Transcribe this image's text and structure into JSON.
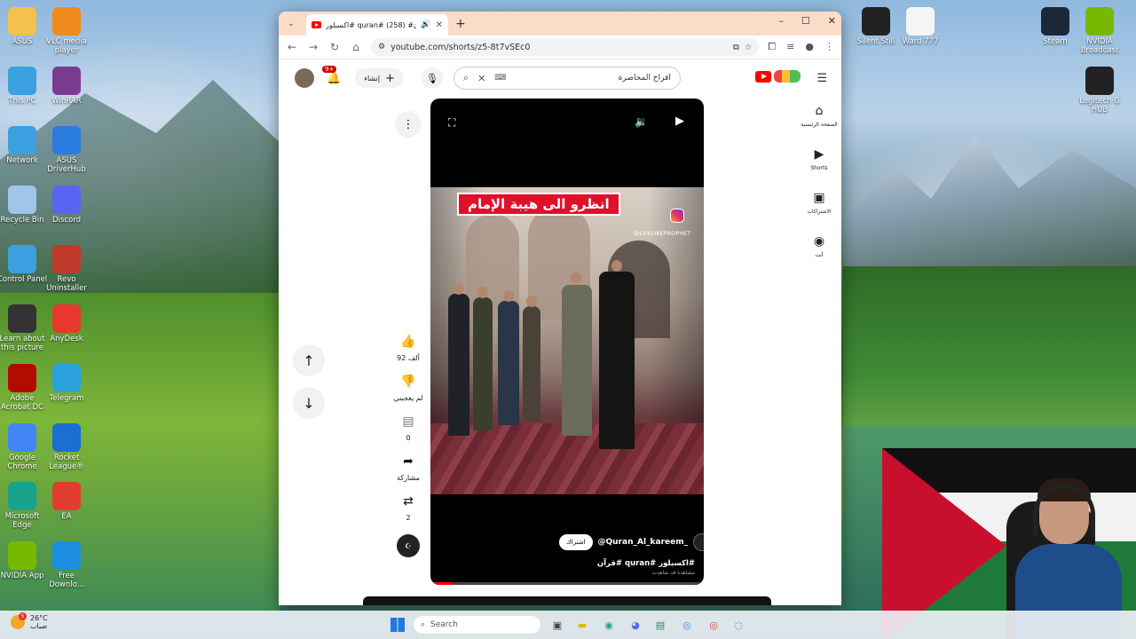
{
  "desktop": {
    "left_icons": [
      {
        "label": "ASUS",
        "icon": "folder-icon",
        "color": "#f2c14e"
      },
      {
        "label": "VLC media player",
        "icon": "vlc-icon",
        "color": "#f08a1d"
      },
      {
        "label": "This PC",
        "icon": "monitor-icon",
        "color": "#3aa0e0"
      },
      {
        "label": "WinRAR",
        "icon": "winrar-icon",
        "color": "#7a3b8e"
      },
      {
        "label": "Network",
        "icon": "network-icon",
        "color": "#3aa0e0"
      },
      {
        "label": "ASUS DriverHub",
        "icon": "driverhub-icon",
        "color": "#2a7be0"
      },
      {
        "label": "Recycle Bin",
        "icon": "recycle-bin-icon",
        "color": "#9fc6e8"
      },
      {
        "label": "Discord",
        "icon": "discord-icon",
        "color": "#5865f2"
      },
      {
        "label": "Control Panel",
        "icon": "control-panel-icon",
        "color": "#3aa0e0"
      },
      {
        "label": "Revo Uninstaller",
        "icon": "revo-icon",
        "color": "#c0392b"
      },
      {
        "label": "Learn about this picture",
        "icon": "camera-icon",
        "color": "#333333"
      },
      {
        "label": "AnyDesk",
        "icon": "anydesk-icon",
        "color": "#e8372c"
      },
      {
        "label": "Adobe Acrobat DC",
        "icon": "acrobat-icon",
        "color": "#b30b00"
      },
      {
        "label": "Telegram",
        "icon": "telegram-icon",
        "color": "#2aa1da"
      },
      {
        "label": "Google Chrome",
        "icon": "chrome-icon",
        "color": "#4285f4"
      },
      {
        "label": "Rocket League®",
        "icon": "rocket-league-icon",
        "color": "#1a6fd1"
      },
      {
        "label": "Microsoft Edge",
        "icon": "edge-icon",
        "color": "#1aa38c"
      },
      {
        "label": "EA",
        "icon": "ea-icon",
        "color": "#e03c2f"
      },
      {
        "label": "NVIDIA App",
        "icon": "nvidia-icon",
        "color": "#76b900"
      },
      {
        "label": "Free Downlo...",
        "icon": "fdm-icon",
        "color": "#1d8ee0"
      }
    ],
    "right_icons": [
      {
        "label": "Silent Still",
        "icon": "file-icon",
        "color": "#222222"
      },
      {
        "label": "Ward 777",
        "icon": "file-icon",
        "color": "#f5f5f5"
      },
      {
        "label": "Steam",
        "icon": "steam-icon",
        "color": "#1b2838"
      },
      {
        "label": "NVIDIA Broadcast",
        "icon": "nvidia-broadcast-icon",
        "color": "#76b900"
      },
      {
        "label": "Logitech G HUB",
        "icon": "logitech-icon",
        "color": "#222222"
      }
    ]
  },
  "browser": {
    "tab_title": "اكسبلور# quran# قرآن# (258)",
    "url": "youtube.com/shorts/z5-8t7vSEc0",
    "window_controls": [
      "–",
      "☐",
      "✕"
    ]
  },
  "youtube": {
    "notification_count": "9+",
    "create_label": "إنشاء",
    "search_query": "افراح المحاصرة",
    "side_nav": [
      {
        "label": "الصفحة الرئيسية",
        "icon": "home-icon"
      },
      {
        "label": "Shorts",
        "icon": "shorts-icon"
      },
      {
        "label": "الاشتراكات",
        "icon": "subscriptions-icon"
      },
      {
        "label": "أنت",
        "icon": "you-icon"
      }
    ],
    "actions": {
      "likes": "92 ألف",
      "dislike_label": "لم يعجبني",
      "comments": "0",
      "share_label": "مشاركة",
      "remix_count": "2"
    },
    "short": {
      "banner_text": "انظرو الى هيبة الإمام",
      "watermark": "@LIFELIKEPROPHET",
      "channel": "@Quran_Al_kareem_",
      "subscribe_label": "اشتراك",
      "hashtags": "#اكسبلور #quran #قرآن",
      "subcaption": "مشاهدة قد شاهدت",
      "progress": 0.08
    }
  },
  "taskbar": {
    "temperature": "26°C",
    "weather_desc": "ضباب",
    "weather_alert": "5",
    "search_placeholder": "Search"
  }
}
